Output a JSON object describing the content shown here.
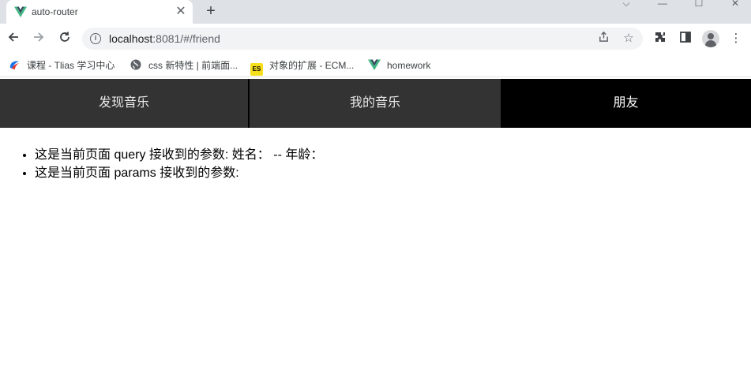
{
  "browser": {
    "tab": {
      "title": "auto-router",
      "close": "✕"
    },
    "new_tab": "+",
    "window_controls": {
      "dropdown": "⌵",
      "minimize": "—",
      "maximize": "☐",
      "close": "✕"
    },
    "address": {
      "host": "localhost",
      "rest": ":8081/#/friend"
    }
  },
  "bookmarks": [
    {
      "label": "课程 - Tlias 学习中心",
      "icon": "tlias-icon"
    },
    {
      "label": "css 新特性 | 前端面...",
      "icon": "globe-icon"
    },
    {
      "label": "对象的扩展 - ECM...",
      "icon": "es-icon",
      "icon_text": "ES"
    },
    {
      "label": "homework",
      "icon": "vue-icon"
    }
  ],
  "nav": {
    "items": [
      {
        "label": "发现音乐",
        "active": false
      },
      {
        "label": "我的音乐",
        "active": false
      },
      {
        "label": "朋友",
        "active": true
      }
    ]
  },
  "content": {
    "lines": [
      "这是当前页面 query 接收到的参数: 姓名：  -- 年龄：",
      "这是当前页面 params 接收到的参数:"
    ]
  },
  "colors": {
    "nav_bg": "#333333",
    "nav_active": "#000000",
    "vue_green": "#41b883",
    "vue_dark": "#35495e"
  }
}
